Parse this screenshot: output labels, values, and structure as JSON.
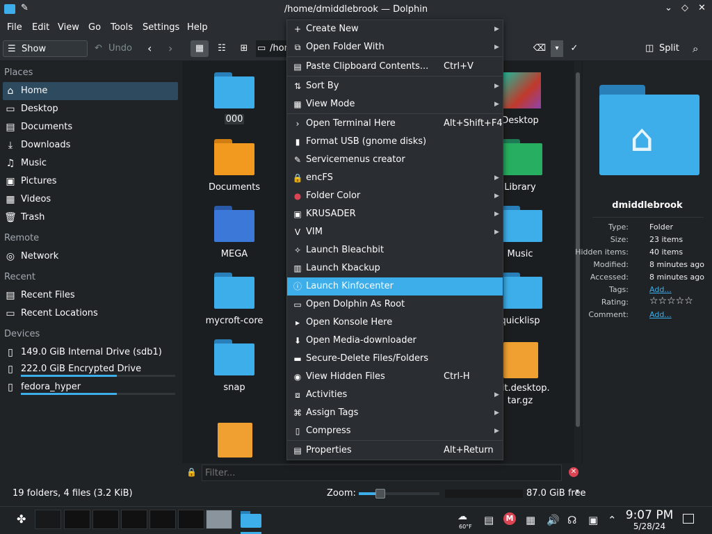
{
  "window": {
    "title": "/home/dmiddlebrook — Dolphin"
  },
  "menubar": [
    "File",
    "Edit",
    "View",
    "Go",
    "Tools",
    "Settings",
    "Help"
  ],
  "toolbar": {
    "show_menubar": "Show Menubar",
    "undo": "Undo",
    "path": "/hor",
    "split": "Split"
  },
  "places": {
    "places_header": "Places",
    "items": [
      "Home",
      "Desktop",
      "Documents",
      "Downloads",
      "Music",
      "Pictures",
      "Videos",
      "Trash"
    ],
    "remote_header": "Remote",
    "remote": [
      "Network"
    ],
    "recent_header": "Recent",
    "recent": [
      "Recent Files",
      "Recent Locations"
    ],
    "devices_header": "Devices",
    "devices": [
      "149.0 GiB Internal Drive (sdb1)",
      "222.0 GiB Encrypted Drive",
      "fedora_hyper"
    ],
    "device_usage": [
      0.0,
      0.62,
      0.62
    ]
  },
  "files": {
    "left": [
      "000",
      "Documents",
      "MEGA",
      "mycroft-core",
      "snap"
    ],
    "right": [
      "Desktop",
      "Library",
      "Music",
      "quicklisp",
      "hbit.desktop.\ntar.gz"
    ]
  },
  "context_menu": [
    {
      "label": "Create New",
      "shortcut": "",
      "submenu": true,
      "icon": "plus-icon"
    },
    {
      "label": "Open Folder With",
      "shortcut": "",
      "submenu": true,
      "icon": "open-with-icon"
    },
    {
      "label": "Paste Clipboard Contents...",
      "shortcut": "Ctrl+V",
      "submenu": false,
      "icon": "paste-icon"
    },
    {
      "label": "Sort By",
      "shortcut": "",
      "submenu": true,
      "icon": "sort-icon"
    },
    {
      "label": "View Mode",
      "shortcut": "",
      "submenu": true,
      "icon": "view-mode-icon"
    },
    {
      "label": "Open Terminal Here",
      "shortcut": "Alt+Shift+F4",
      "submenu": false,
      "icon": "terminal-icon"
    },
    {
      "label": "Format USB (gnome disks)",
      "shortcut": "",
      "submenu": false,
      "icon": "usb-icon"
    },
    {
      "label": "Servicemenus creator",
      "shortcut": "",
      "submenu": false,
      "icon": "servicemenu-icon"
    },
    {
      "label": "encFS",
      "shortcut": "",
      "submenu": true,
      "icon": "lock-icon"
    },
    {
      "label": "Folder Color",
      "shortcut": "",
      "submenu": true,
      "icon": "color-drop-icon"
    },
    {
      "label": "KRUSADER",
      "shortcut": "",
      "submenu": true,
      "icon": "krusader-icon"
    },
    {
      "label": "VIM",
      "shortcut": "",
      "submenu": true,
      "icon": "vim-icon"
    },
    {
      "label": "Launch Bleachbit",
      "shortcut": "",
      "submenu": false,
      "icon": "bleachbit-icon"
    },
    {
      "label": "Launch Kbackup",
      "shortcut": "",
      "submenu": false,
      "icon": "kbackup-icon"
    },
    {
      "label": "Launch Kinfocenter",
      "shortcut": "",
      "submenu": false,
      "icon": "kinfocenter-icon"
    },
    {
      "label": "Open Dolphin As Root",
      "shortcut": "",
      "submenu": false,
      "icon": "dolphin-icon"
    },
    {
      "label": "Open Konsole Here",
      "shortcut": "",
      "submenu": false,
      "icon": "konsole-icon"
    },
    {
      "label": "Open Media-downloader",
      "shortcut": "",
      "submenu": false,
      "icon": "download-icon"
    },
    {
      "label": "Secure-Delete Files/Folders",
      "shortcut": "",
      "submenu": false,
      "icon": "shred-icon"
    },
    {
      "label": "View Hidden Files",
      "shortcut": "Ctrl-H",
      "submenu": false,
      "icon": "eye-icon"
    },
    {
      "label": "Activities",
      "shortcut": "",
      "submenu": true,
      "icon": "activities-icon"
    },
    {
      "label": "Assign Tags",
      "shortcut": "",
      "submenu": true,
      "icon": "tag-icon"
    },
    {
      "label": "Compress",
      "shortcut": "",
      "submenu": true,
      "icon": "compress-icon"
    },
    {
      "label": "Properties",
      "shortcut": "Alt+Return",
      "submenu": false,
      "icon": "properties-icon"
    }
  ],
  "info": {
    "name": "dmiddlebrook",
    "rows": [
      {
        "k": "Type:",
        "v": "Folder"
      },
      {
        "k": "Size:",
        "v": "23 items"
      },
      {
        "k": "Hidden items:",
        "v": "40 items"
      },
      {
        "k": "Modified:",
        "v": "8 minutes ago"
      },
      {
        "k": "Accessed:",
        "v": "8 minutes ago"
      },
      {
        "k": "Tags:",
        "v": "Add..."
      },
      {
        "k": "Rating:",
        "v": "☆☆☆☆☆"
      },
      {
        "k": "Comment:",
        "v": "Add..."
      }
    ]
  },
  "filter": {
    "placeholder": "Filter..."
  },
  "status": {
    "summary": "19 folders, 4 files (3.2 KiB)",
    "zoom_label": "Zoom:",
    "free": "87.0 GiB free"
  },
  "taskbar": {
    "time": "9:07 PM",
    "date": "5/28/24",
    "temp": "60°F"
  },
  "colors": {
    "accent": "#3daee9",
    "folder": "#3daee9",
    "window": "#2a2e32"
  }
}
